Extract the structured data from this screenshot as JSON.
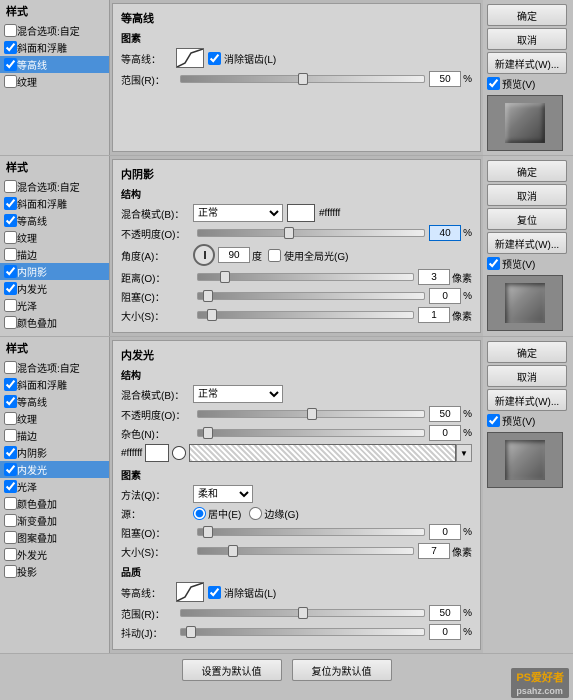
{
  "panels": {
    "panel1": {
      "title": "等高线",
      "subsection": "图素",
      "contour_label": "等高线：",
      "remove_jagged": "消除锯齿(L)",
      "range_label": "范围(R)：",
      "range_value": "50",
      "range_unit": "%"
    },
    "panel2": {
      "title": "内阴影",
      "subsection": "结构",
      "blend_mode_label": "混合模式(B)：",
      "blend_mode_value": "正常",
      "opacity_label": "不透明度(O)：",
      "opacity_value": "40",
      "opacity_unit": "%",
      "angle_label": "角度(A)：",
      "angle_value": "90",
      "angle_unit": "度",
      "global_light": "使用全局光(G)",
      "distance_label": "距离(O)：",
      "distance_value": "3",
      "distance_unit": "像素",
      "choke_label": "阻塞(C)：",
      "choke_value": "0",
      "choke_unit": "%",
      "size_label": "大小(S)：",
      "size_value": "1",
      "size_unit": "像素",
      "color_hex": "#ffffff"
    },
    "panel3": {
      "title": "内发光",
      "subsection_structure": "结构",
      "blend_mode_label": "混合模式(B)：",
      "blend_mode_value": "正常",
      "opacity_label": "不透明度(O)：",
      "opacity_value": "50",
      "opacity_unit": "%",
      "noise_label": "杂色(N)：",
      "noise_value": "0",
      "noise_unit": "%",
      "color_hex": "#ffffff",
      "subsection_elements": "图素",
      "method_label": "方法(Q)：",
      "method_value": "柔和",
      "source_label": "源：",
      "source_center": "居中(E)",
      "source_edge": "边缘(G)",
      "choke_label": "阻塞(O)：",
      "choke_value": "0",
      "choke_unit": "%",
      "size_label": "大小(S)：",
      "size_value": "7",
      "size_unit": "像素",
      "subsection_quality": "品质",
      "contour_label": "等高线：",
      "remove_jagged": "消除锯齿(L)",
      "range_label": "范围(R)：",
      "range_value": "50",
      "range_unit": "%",
      "jitter_label": "抖动(J)：",
      "jitter_value": "0",
      "jitter_unit": "%"
    }
  },
  "sidebar": {
    "section1": {
      "title": "样式",
      "items": [
        {
          "label": "混合选项:自定",
          "checked": false,
          "active": false
        },
        {
          "label": "斜面和浮雕",
          "checked": true,
          "active": false
        },
        {
          "label": "等高线",
          "checked": true,
          "active": true
        },
        {
          "label": "纹理",
          "checked": false,
          "active": false
        }
      ]
    },
    "section2": {
      "title": "样式",
      "items": [
        {
          "label": "混合选项:自定",
          "checked": false,
          "active": false
        },
        {
          "label": "斜面和浮雕",
          "checked": true,
          "active": false
        },
        {
          "label": "等高线",
          "checked": true,
          "active": false
        },
        {
          "label": "纹理",
          "checked": false,
          "active": false
        },
        {
          "label": "描边",
          "checked": false,
          "active": false
        },
        {
          "label": "内阴影",
          "checked": true,
          "active": true
        },
        {
          "label": "内发光",
          "checked": true,
          "active": false
        },
        {
          "label": "光泽",
          "checked": false,
          "active": false
        },
        {
          "label": "颜色叠加",
          "checked": false,
          "active": false
        }
      ]
    },
    "section3": {
      "title": "样式",
      "items": [
        {
          "label": "混合选项:自定",
          "checked": false,
          "active": false
        },
        {
          "label": "斜面和浮雕",
          "checked": true,
          "active": false
        },
        {
          "label": "等高线",
          "checked": true,
          "active": false
        },
        {
          "label": "纹理",
          "checked": false,
          "active": false
        },
        {
          "label": "描边",
          "checked": false,
          "active": false
        },
        {
          "label": "内阴影",
          "checked": true,
          "active": false
        },
        {
          "label": "内发光",
          "checked": true,
          "active": true
        },
        {
          "label": "光泽",
          "checked": true,
          "active": false
        },
        {
          "label": "颜色叠加",
          "checked": false,
          "active": false
        },
        {
          "label": "渐变叠加",
          "checked": false,
          "active": false
        },
        {
          "label": "图案叠加",
          "checked": false,
          "active": false
        },
        {
          "label": "外发光",
          "checked": false,
          "active": false
        },
        {
          "label": "投影",
          "checked": false,
          "active": false
        }
      ]
    }
  },
  "buttons": {
    "ok": "确定",
    "cancel": "取消",
    "new_style": "新建样式(W)...",
    "preview": "预览(V)",
    "reset": "复位",
    "set_default": "设置为默认值",
    "reset_default": "复位为默认值"
  }
}
